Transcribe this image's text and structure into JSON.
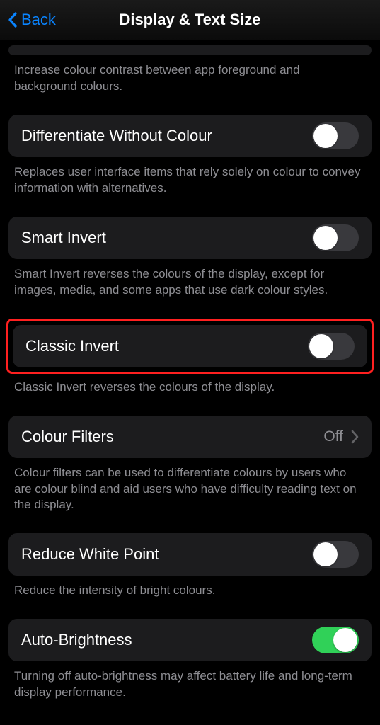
{
  "nav": {
    "back": "Back",
    "title": "Display & Text Size"
  },
  "stub_desc": "Increase colour contrast between app foreground and background colours.",
  "items": {
    "diff": {
      "label": "Differentiate Without Colour",
      "desc": "Replaces user interface items that rely solely on colour to convey information with alternatives."
    },
    "smart": {
      "label": "Smart Invert",
      "desc": "Smart Invert reverses the colours of the display, except for images, media, and some apps that use dark colour styles."
    },
    "classic": {
      "label": "Classic Invert",
      "desc": "Classic Invert reverses the colours of the display."
    },
    "filters": {
      "label": "Colour Filters",
      "value": "Off",
      "desc": "Colour filters can be used to differentiate colours by users who are colour blind and aid users who have difficulty reading text on the display."
    },
    "white": {
      "label": "Reduce White Point",
      "desc": "Reduce the intensity of bright colours."
    },
    "auto": {
      "label": "Auto-Brightness",
      "desc": "Turning off auto-brightness may affect battery life and long-term display performance."
    }
  }
}
